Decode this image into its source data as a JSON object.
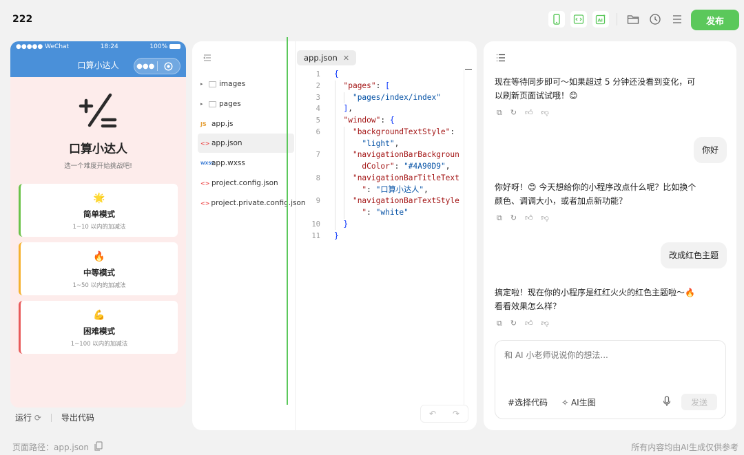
{
  "header": {
    "project_name": "222",
    "publish_label": "发布",
    "accent": "#5bc85b"
  },
  "toolbar_icons": [
    "phone-icon",
    "code-icon",
    "ai-image-icon",
    "folder-icon",
    "clock-icon",
    "menu-icon"
  ],
  "phone": {
    "status": {
      "carrier": "●●●●● WeChat",
      "time": "18:24",
      "battery": "100%"
    },
    "nav_title": "口算小达人",
    "nav_color": "#4A90D9",
    "hero_symbol": "+/=",
    "title": "口算小达人",
    "subtitle": "选一个难度开始挑战吧!",
    "modes": [
      {
        "emoji": "🌟",
        "name": "简单模式",
        "desc": "1~10 以内的加减法",
        "color": "#6cc24a"
      },
      {
        "emoji": "🔥",
        "name": "中等模式",
        "desc": "1~50 以内的加减法",
        "color": "#f5b12f"
      },
      {
        "emoji": "💪",
        "name": "困难模式",
        "desc": "1~100 以内的加减法",
        "color": "#e85a5a"
      }
    ]
  },
  "run_bar": {
    "run_label": "运行",
    "export_label": "导出代码"
  },
  "file_tree": [
    {
      "name": "images",
      "type": "folder"
    },
    {
      "name": "pages",
      "type": "folder"
    },
    {
      "name": "app.js",
      "type": "js"
    },
    {
      "name": "app.json",
      "type": "json",
      "active": true
    },
    {
      "name": "app.wxss",
      "type": "wxss"
    },
    {
      "name": "project.config.json",
      "type": "json"
    },
    {
      "name": "project.private.config.json",
      "type": "json"
    }
  ],
  "editor": {
    "tab_label": "app.json",
    "line_numbers": [
      "1",
      "2",
      "3",
      "4",
      "5",
      "6",
      "",
      "7",
      "",
      "8",
      "",
      "9",
      "",
      "10",
      "11"
    ]
  },
  "chat": {
    "messages": [
      {
        "role": "ai",
        "text": "现在等待同步即可～如果超过 5 分钟还没看到变化，可以刷新页面试试哦！😊"
      },
      {
        "role": "user",
        "text": "你好"
      },
      {
        "role": "ai",
        "text": "你好呀！😊 今天想给你的小程序改点什么呢？比如换个颜色、调调大小，或者加点新功能？"
      },
      {
        "role": "user",
        "text": "改成红色主题"
      },
      {
        "role": "ai",
        "text": "搞定啦！现在你的小程序是红红火火的红色主题啦～🔥看看效果怎么样？"
      }
    ],
    "input_placeholder": "和 AI 小老师说说你的想法...",
    "select_code_label": "#选择代码",
    "ai_image_label": "AI生图",
    "send_label": "发送"
  },
  "footer": {
    "path_label": "页面路径：app.json",
    "disclaimer": "所有内容均由AI生成仅供参考"
  }
}
